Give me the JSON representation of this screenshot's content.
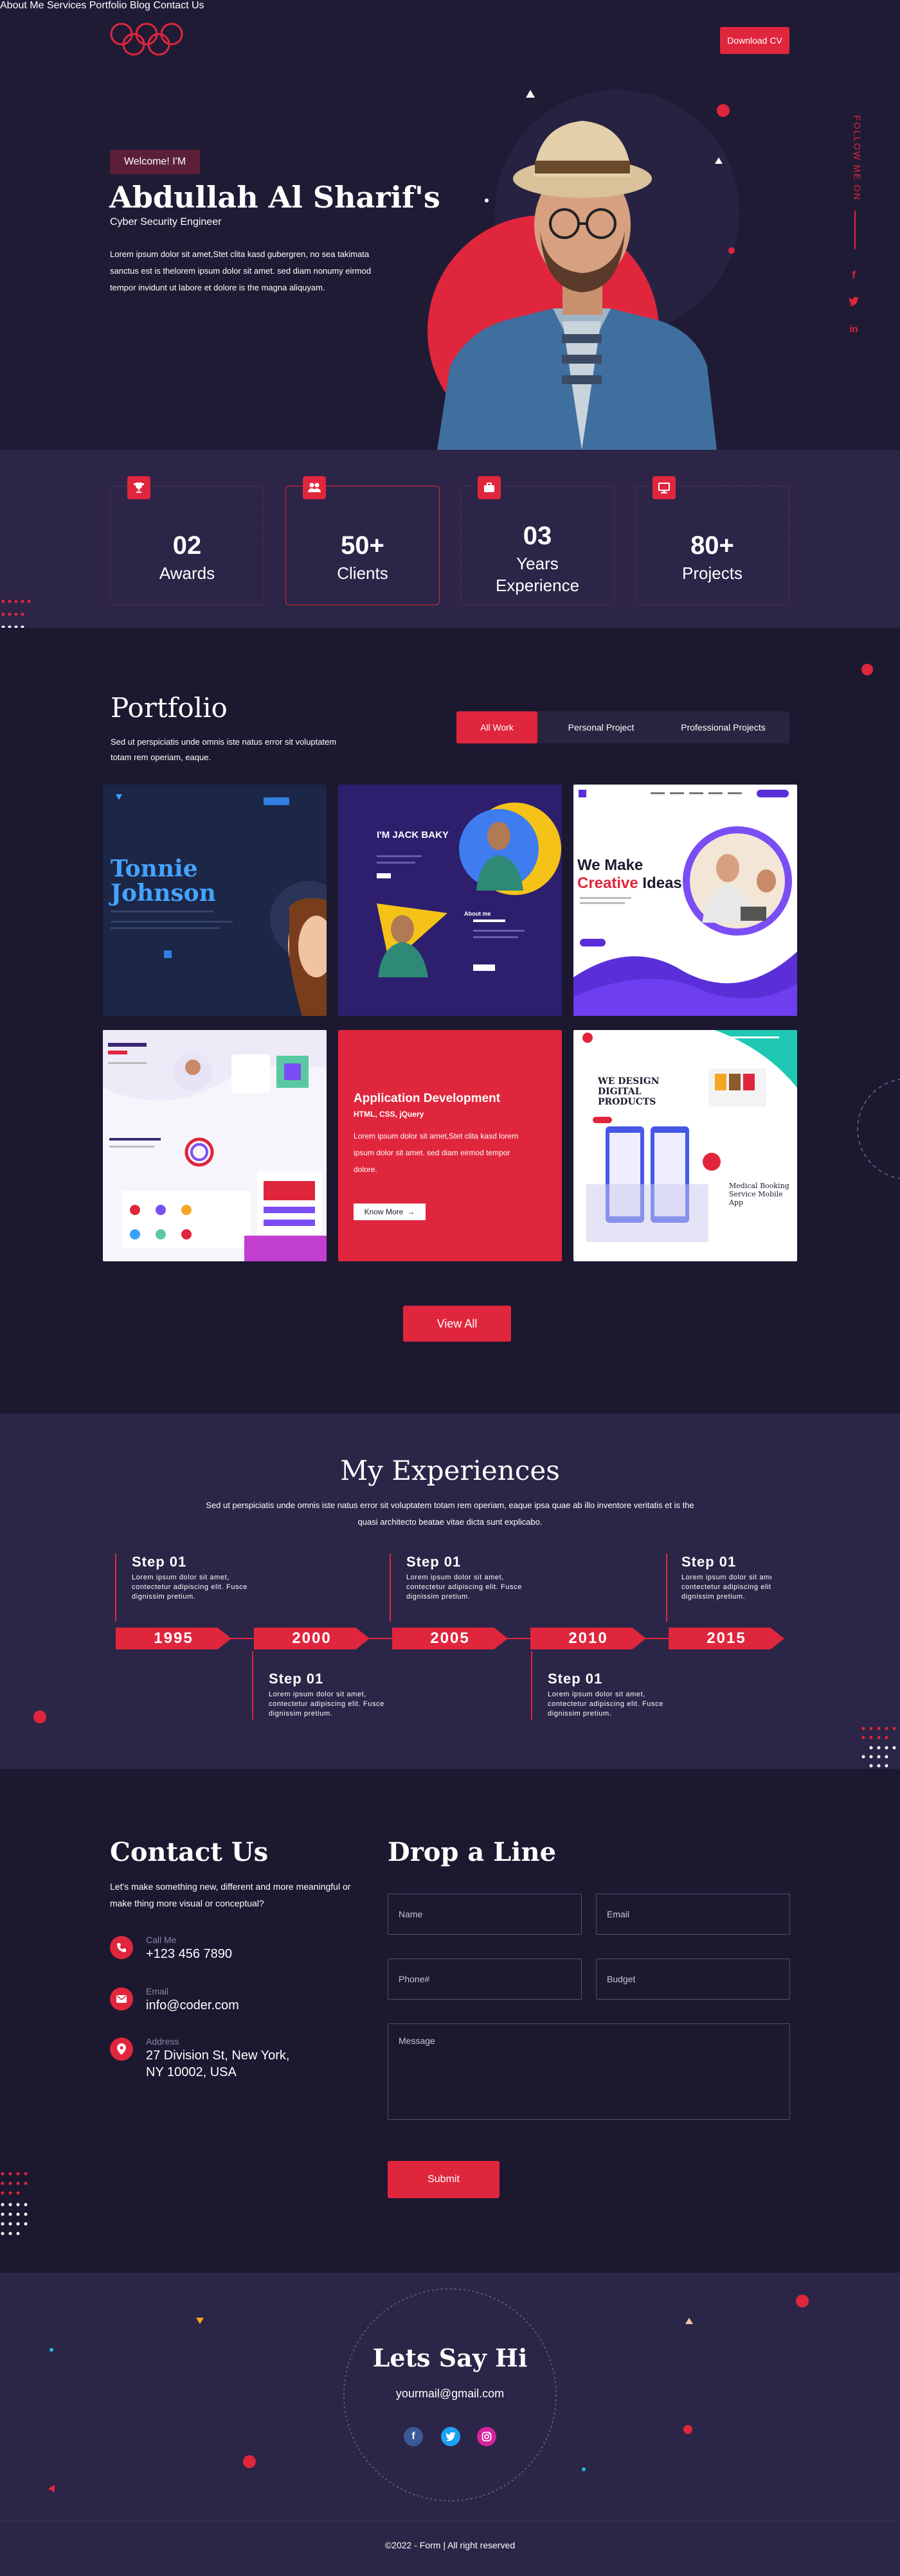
{
  "nav": {
    "items": [
      "About Me",
      "Services",
      "Portfolio",
      "Blog",
      "Contact Us"
    ],
    "cta": "Download CV"
  },
  "hero": {
    "badge": "Welcome! I'M",
    "name": "Abdullah Al Sharif's",
    "role": "Cyber Security Engineer",
    "intro": "Lorem ipsum dolor sit amet,Stet clita kasd gubergren, no sea takimata sanctus est is thelorem ipsum dolor sit amet. sed diam nonumy eirmod tempor invidunt ut labore et dolore is the magna aliquyam.",
    "follow": "FOLLOW ME ON"
  },
  "stats": [
    {
      "num": "02",
      "label": "Awards",
      "icon": "trophy-icon"
    },
    {
      "num": "50+",
      "label": "Clients",
      "icon": "users-icon"
    },
    {
      "num": "03",
      "label": "Years Experience",
      "icon": "briefcase-icon"
    },
    {
      "num": "80+",
      "label": "Projects",
      "icon": "monitor-icon"
    }
  ],
  "portfolio": {
    "title": "Portfolio",
    "desc": "Sed ut perspiciatis unde omnis iste natus error sit voluptatem  totam rem operiam, eaque.",
    "tabs": [
      "All Work",
      "Personal Project",
      "Professional Projects"
    ],
    "active_tab": "All Work",
    "cards": {
      "c1_name": "Tonnie Johnson",
      "c2_title": "I'M JACK BAKY",
      "c2_about": "About me",
      "c3_title_a": "We Make",
      "c3_title_b": "Creative",
      "c3_title_c": "Ideas",
      "c5_title": "Application Development",
      "c5_sub": "HTML, CSS, jQuery",
      "c5_desc": "Lorem ipsum dolor sit amet,Stet clita kasd lorem ipsum dolor sit amet. sed diam eirmod tempor dolore.",
      "c5_btn": "Know More",
      "c6_title": "WE DESIGN DIGITAL PRODUCTS",
      "c6_app": "Medical Booking Service Mobile App"
    },
    "view_all": "View All"
  },
  "experiences": {
    "title": "My Experiences",
    "desc": "Sed ut perspiciatis unde omnis iste natus error sit voluptatem  totam rem operiam, eaque ipsa quae ab illo inventore veritatis et is the quasi architecto beatae vitae dicta sunt explicabo.",
    "steps": [
      {
        "title": "Step 01",
        "text": "Lorem ipsum dolor sit amet, contectetur adipiscing elit. Fusce dignissim pretium."
      },
      {
        "title": "Step 01",
        "text": "Lorem ipsum dolor sit amet, contectetur adipiscing elit. Fusce dignissim pretium."
      },
      {
        "title": "Step 01",
        "text": "Lorem ipsum dolor sit amet, contectetur adipiscing elit. Fusce dignissim pretium."
      },
      {
        "title": "Step 01",
        "text": "Lorem ipsum dolor sit amet, contectetur adipiscing elit. Fusce dignissim pretium."
      },
      {
        "title": "Step 01",
        "text": "Lorem ipsum dolor sit amet, contectetur adipiscing elit. Fusce dignissim pretium."
      }
    ],
    "years": [
      "1995",
      "2000",
      "2005",
      "2010",
      "2015"
    ]
  },
  "contact": {
    "title": "Contact Us",
    "desc": "Let's make something new, different and more meaningful or make thing more visual or conceptual?",
    "call_label": "Call Me",
    "call_value": "+123 456 7890",
    "email_label": "Email",
    "email_value": "info@coder.com",
    "address_label": "Address",
    "address_value": "27 Division St, New York, NY 10002, USA"
  },
  "form": {
    "title": "Drop a Line",
    "name": "Name",
    "email": "Email",
    "phone": "Phone#",
    "budget": "Budget",
    "message": "Message",
    "submit": "Submit"
  },
  "footer": {
    "title": "Lets Say Hi",
    "email": "yourmail@gmail.com",
    "copyright": "©2022 - Form  |   All right reserved"
  },
  "colors": {
    "accent": "#e0263d",
    "bg": "#1c1830",
    "panel": "#2b2547"
  }
}
